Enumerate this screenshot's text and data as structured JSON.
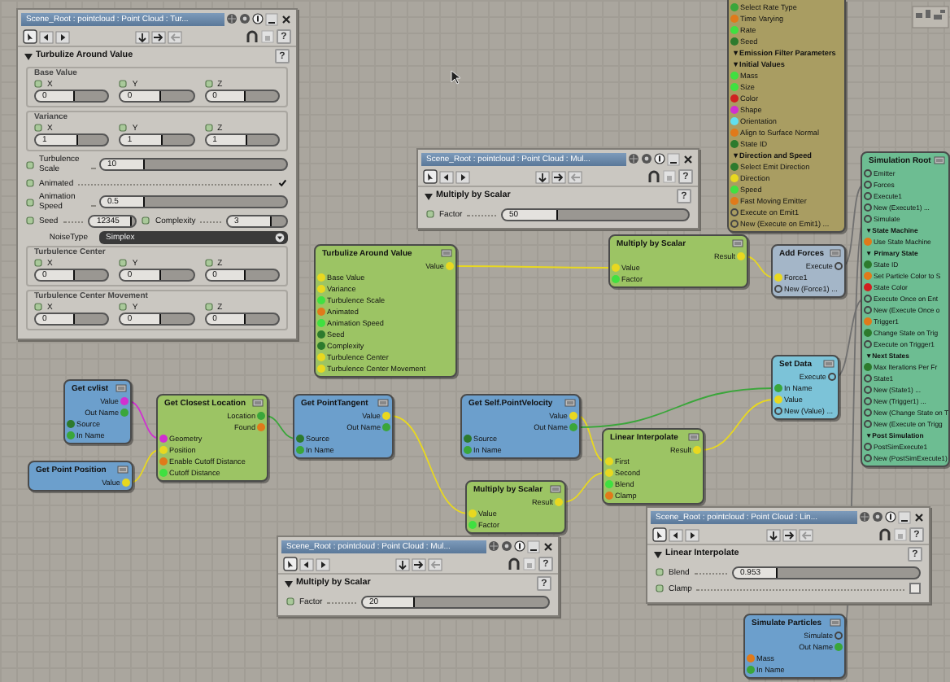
{
  "nodes": [
    {
      "color": "#a99d62",
      "rows": [
        {
          "label": "Select Rate Type",
          "kind": "input",
          "color": "#3aa63a"
        },
        {
          "label": "Time Varying",
          "kind": "input",
          "color": "#e07a1a"
        },
        {
          "label": "Rate",
          "kind": "input",
          "color": "#40e040"
        },
        {
          "label": "Seed",
          "kind": "input",
          "color": "#2d7a2d"
        },
        {
          "label": "▼Emission Filter Parameters",
          "kind": "group"
        },
        {
          "label": "▼Initial Values",
          "kind": "group"
        },
        {
          "label": "Mass",
          "kind": "input",
          "color": "#40e040"
        },
        {
          "label": "Size",
          "kind": "input",
          "color": "#40e040"
        },
        {
          "label": "Color",
          "kind": "input",
          "color": "#d02020"
        },
        {
          "label": "Shape",
          "kind": "input",
          "color": "#d030d0"
        },
        {
          "label": "Orientation",
          "kind": "input",
          "color": "#60e0f0"
        },
        {
          "label": "Align to Surface Normal",
          "kind": "input",
          "color": "#e07a1a"
        },
        {
          "label": "State ID",
          "kind": "input",
          "color": "#2d7a2d"
        },
        {
          "label": "▼Direction and Speed",
          "kind": "group"
        },
        {
          "label": "Select Emit Direction",
          "kind": "input",
          "color": "#2d7a2d"
        },
        {
          "label": "Direction",
          "kind": "input",
          "color": "#e8d820"
        },
        {
          "label": "Speed",
          "kind": "input",
          "color": "#40e040"
        },
        {
          "label": "Fast Moving Emitter",
          "kind": "input",
          "color": "#e07a1a"
        },
        {
          "label": "Execute on Emit1",
          "kind": "input"
        },
        {
          "label": "New (Execute on Emit1) ...",
          "kind": "input"
        }
      ]
    },
    {
      "title": "Turbulize Around Value",
      "color": "#9cc464",
      "rows": [
        {
          "label": "Value",
          "kind": "output",
          "color": "#e8d820"
        },
        {
          "label": "Base Value",
          "kind": "input",
          "color": "#e8d820"
        },
        {
          "label": "Variance",
          "kind": "input",
          "color": "#e8d820"
        },
        {
          "label": "Turbulence Scale",
          "kind": "input",
          "color": "#40e040"
        },
        {
          "label": "Animated",
          "kind": "input",
          "color": "#e07a1a"
        },
        {
          "label": "Animation Speed",
          "kind": "input",
          "color": "#40e040"
        },
        {
          "label": "Seed",
          "kind": "input",
          "color": "#2d7a2d"
        },
        {
          "label": "Complexity",
          "kind": "input",
          "color": "#2d7a2d"
        },
        {
          "label": "Turbulence Center",
          "kind": "input",
          "color": "#e8d820"
        },
        {
          "label": "Turbulence Center Movement",
          "kind": "input",
          "color": "#e8d820"
        }
      ]
    },
    {
      "title": "Multiply by Scalar",
      "color": "#9cc464",
      "rows": [
        {
          "label": "Result",
          "kind": "output",
          "color": "#e8d820"
        },
        {
          "label": "Value",
          "kind": "input",
          "color": "#e8d820"
        },
        {
          "label": "Factor",
          "kind": "input",
          "color": "#40e040"
        }
      ]
    },
    {
      "title": "Add Forces",
      "color": "#a4b6c8",
      "rows": [
        {
          "label": "Execute",
          "kind": "output"
        },
        {
          "label": "Force1",
          "kind": "input",
          "color": "#e8d820"
        },
        {
          "label": "New (Force1) ...",
          "kind": "input"
        }
      ]
    },
    {
      "title": "Set Data",
      "color": "#7cc3d8",
      "rows": [
        {
          "label": "Execute",
          "kind": "output"
        },
        {
          "label": "In Name",
          "kind": "input",
          "color": "#3aa63a"
        },
        {
          "label": "Value",
          "kind": "input",
          "color": "#e8d820"
        },
        {
          "label": "New (Value) ...",
          "kind": "input"
        }
      ]
    },
    {
      "title": "Get cvlist",
      "color": "#6c9fcc",
      "rows": [
        {
          "label": "Value",
          "kind": "output",
          "color": "#d030d0"
        },
        {
          "label": "Out Name",
          "kind": "output",
          "color": "#3aa63a"
        },
        {
          "label": "Source",
          "kind": "input",
          "color": "#2d7a2d"
        },
        {
          "label": "In Name",
          "kind": "input",
          "color": "#3aa63a"
        }
      ]
    },
    {
      "title": "Get Closest Location",
      "color": "#9cc464",
      "rows": [
        {
          "label": "Location",
          "kind": "output",
          "color": "#3aa63a"
        },
        {
          "label": "Found",
          "kind": "output",
          "color": "#e07a1a"
        },
        {
          "label": "Geometry",
          "kind": "input",
          "color": "#d030d0"
        },
        {
          "label": "Position",
          "kind": "input",
          "color": "#e8d820"
        },
        {
          "label": "Enable Cutoff Distance",
          "kind": "input",
          "color": "#e07a1a"
        },
        {
          "label": "Cutoff Distance",
          "kind": "input",
          "color": "#40e040"
        }
      ]
    },
    {
      "title": "Get PointTangent",
      "color": "#6c9fcc",
      "rows": [
        {
          "label": "Value",
          "kind": "output",
          "color": "#e8d820"
        },
        {
          "label": "Out Name",
          "kind": "output",
          "color": "#3aa63a"
        },
        {
          "label": "Source",
          "kind": "input",
          "color": "#2d7a2d"
        },
        {
          "label": "In Name",
          "kind": "input",
          "color": "#3aa63a"
        }
      ]
    },
    {
      "title": "Get Self.PointVelocity",
      "color": "#6c9fcc",
      "rows": [
        {
          "label": "Value",
          "kind": "output",
          "color": "#e8d820"
        },
        {
          "label": "Out Name",
          "kind": "output",
          "color": "#3aa63a"
        },
        {
          "label": "Source",
          "kind": "input",
          "color": "#2d7a2d"
        },
        {
          "label": "In Name",
          "kind": "input",
          "color": "#3aa63a"
        }
      ]
    },
    {
      "title": "Linear Interpolate",
      "color": "#9cc464",
      "rows": [
        {
          "label": "Result",
          "kind": "output",
          "color": "#e8d820"
        },
        {
          "label": "First",
          "kind": "input",
          "color": "#e8d820"
        },
        {
          "label": "Second",
          "kind": "input",
          "color": "#e8d820"
        },
        {
          "label": "Blend",
          "kind": "input",
          "color": "#40e040"
        },
        {
          "label": "Clamp",
          "kind": "input",
          "color": "#e07a1a"
        }
      ]
    },
    {
      "title": "Get Point Position",
      "color": "#6c9fcc",
      "rows": [
        {
          "label": "Value",
          "kind": "output",
          "color": "#e8d820"
        }
      ]
    },
    {
      "title": "Multiply by Scalar",
      "color": "#9cc464",
      "rows": [
        {
          "label": "Result",
          "kind": "output",
          "color": "#e8d820"
        },
        {
          "label": "Value",
          "kind": "input",
          "color": "#e8d820"
        },
        {
          "label": "Factor",
          "kind": "input",
          "color": "#40e040"
        }
      ]
    },
    {
      "title": "Simulation Root",
      "color": "#6dbd92",
      "rows": [
        {
          "label": "Emitter",
          "kind": "input"
        },
        {
          "label": "Forces",
          "kind": "input"
        },
        {
          "label": "Execute1",
          "kind": "input"
        },
        {
          "label": "New (Execute1) ...",
          "kind": "input"
        },
        {
          "label": "Simulate",
          "kind": "input"
        },
        {
          "label": "▼State Machine",
          "kind": "group"
        },
        {
          "label": "Use State Machine",
          "kind": "input",
          "color": "#e07a1a"
        },
        {
          "label": "▼ Primary State",
          "kind": "group"
        },
        {
          "label": "State ID",
          "kind": "input",
          "color": "#2d7a2d"
        },
        {
          "label": "Set Particle Color to S",
          "kind": "input",
          "color": "#e07a1a"
        },
        {
          "label": "State Color",
          "kind": "input",
          "color": "#d02020"
        },
        {
          "label": "Execute Once on Ent",
          "kind": "input"
        },
        {
          "label": "New (Execute Once o",
          "kind": "input"
        },
        {
          "label": "Trigger1",
          "kind": "input",
          "color": "#e07a1a"
        },
        {
          "label": "Change State on Trig",
          "kind": "input",
          "color": "#2d7a2d"
        },
        {
          "label": "Execute on Trigger1",
          "kind": "input"
        },
        {
          "label": "▼Next States",
          "kind": "group"
        },
        {
          "label": "Max Iterations Per Fr",
          "kind": "input",
          "color": "#2d7a2d"
        },
        {
          "label": "State1",
          "kind": "input"
        },
        {
          "label": "New (State1) ...",
          "kind": "input"
        },
        {
          "label": "New (Trigger1) ...",
          "kind": "input"
        },
        {
          "label": "New (Change State on T",
          "kind": "input"
        },
        {
          "label": "New (Execute on Trigg",
          "kind": "input"
        },
        {
          "label": "▼Post Simulation",
          "kind": "group"
        },
        {
          "label": "PostSimExecute1",
          "kind": "input"
        },
        {
          "label": "New (PostSimExecute1)",
          "kind": "input"
        }
      ]
    },
    {
      "title": "Simulate Particles",
      "color": "#6c9fcc",
      "rows": [
        {
          "label": "Simulate",
          "kind": "output"
        },
        {
          "label": "Out Name",
          "kind": "output",
          "color": "#3aa63a"
        },
        {
          "label": "Mass",
          "kind": "input",
          "color": "#e07a1a"
        },
        {
          "label": "In Name",
          "kind": "input",
          "color": "#3aa63a"
        }
      ]
    }
  ],
  "panels": [
    {
      "title": "Scene_Root : pointcloud : Point Cloud : Tur...",
      "section": "Turbulize Around Value",
      "toolbar_help": "?",
      "section_help": "?",
      "items": [
        {
          "kind": "xyz",
          "label": "Base Value",
          "fields": [
            {
              "axis": "X",
              "value": "0",
              "level": 0.55
            },
            {
              "axis": "Y",
              "value": "0",
              "level": 0.55
            },
            {
              "axis": "Z",
              "value": "0",
              "level": 0.55
            }
          ]
        },
        {
          "kind": "xyz",
          "label": "Variance",
          "fields": [
            {
              "axis": "X",
              "value": "1",
              "level": 0.58
            },
            {
              "axis": "Y",
              "value": "1",
              "level": 0.58
            },
            {
              "axis": "Z",
              "value": "1",
              "level": 0.58
            }
          ]
        },
        {
          "kind": "slider",
          "label": "Turbulence Scale",
          "value": "10",
          "level": 0.24
        },
        {
          "kind": "check",
          "label": "Animated",
          "checked": true
        },
        {
          "kind": "slider",
          "label": "Animation Speed",
          "value": "0.5",
          "level": 0.24
        },
        {
          "kind": "pair",
          "items": [
            {
              "label": "Seed",
              "value": "12345",
              "level": 0.9
            },
            {
              "label": "Complexity",
              "value": "3",
              "level": 0.75
            }
          ]
        },
        {
          "kind": "dropdown",
          "label": "NoiseType",
          "value": "Simplex"
        },
        {
          "kind": "xyz",
          "label": "Turbulence Center",
          "fields": [
            {
              "axis": "X",
              "value": "0",
              "level": 0.55
            },
            {
              "axis": "Y",
              "value": "0",
              "level": 0.55
            },
            {
              "axis": "Z",
              "value": "0",
              "level": 0.55
            }
          ]
        },
        {
          "kind": "xyz",
          "label": "Turbulence Center Movement",
          "fields": [
            {
              "axis": "X",
              "value": "0",
              "level": 0.55
            },
            {
              "axis": "Y",
              "value": "0",
              "level": 0.55
            },
            {
              "axis": "Z",
              "value": "0",
              "level": 0.55
            }
          ]
        }
      ]
    },
    {
      "title": "Scene_Root : pointcloud : Point Cloud : Mul...",
      "section": "Multiply by Scalar",
      "toolbar_help": "?",
      "section_help": "?",
      "items": [
        {
          "kind": "slider",
          "label": "Factor",
          "value": "50",
          "level": 0.3
        }
      ]
    },
    {
      "title": "Scene_Root : pointcloud : Point Cloud : Mul...",
      "section": "Multiply by Scalar",
      "toolbar_help": "?",
      "section_help": "?",
      "items": [
        {
          "kind": "slider",
          "label": "Factor",
          "value": "20",
          "level": 0.28
        }
      ]
    },
    {
      "title": "Scene_Root : pointcloud : Point Cloud : Lin...",
      "section": "Linear Interpolate",
      "toolbar_help": "?",
      "section_help": "?",
      "items": [
        {
          "kind": "slider",
          "label": "Blend",
          "value": "0.953",
          "level": 0.24
        },
        {
          "kind": "check",
          "label": "Clamp",
          "checked": false
        }
      ]
    }
  ]
}
